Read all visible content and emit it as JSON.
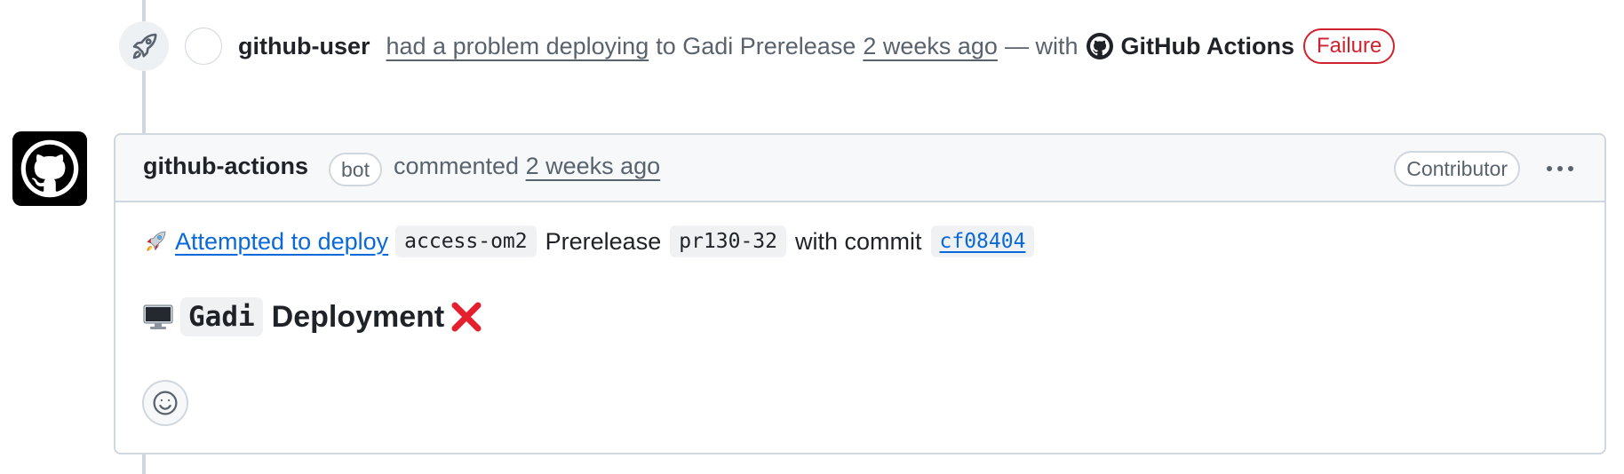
{
  "event": {
    "icon": "rocket-icon",
    "actor": "github-user",
    "action_link": "had a problem deploying",
    "to_text": "to Gadi Prerelease",
    "time": "2 weeks ago",
    "with_text": "— with",
    "app_icon": "github-mark-icon",
    "app_name": "GitHub Actions",
    "status": "Failure",
    "status_color": "#cf222e"
  },
  "comment": {
    "avatar_icon": "github-mark-icon",
    "author": "github-actions",
    "bot_badge": "bot",
    "commented": "commented",
    "time": "2 weeks ago",
    "role_badge": "Contributor",
    "menu_icon": "kebab-horizontal-icon",
    "body": {
      "rocket_emoji_icon": "rocket-emoji-icon",
      "deploy_link": "Attempted to deploy",
      "repo_code": "access-om2",
      "prerelease_text": "Prerelease",
      "tag_code": "pr130-32",
      "with_commit_text": "with commit",
      "commit_link": "cf08404",
      "heading_icon": "computer-monitor-icon",
      "heading_code": "Gadi",
      "heading_text": "Deployment",
      "heading_status_icon": "red-cross-icon"
    },
    "reaction_icon": "smiley-icon"
  },
  "colors": {
    "link": "#0969da",
    "muted": "#59636e",
    "border": "#d0d7de",
    "failure": "#cf222e"
  }
}
